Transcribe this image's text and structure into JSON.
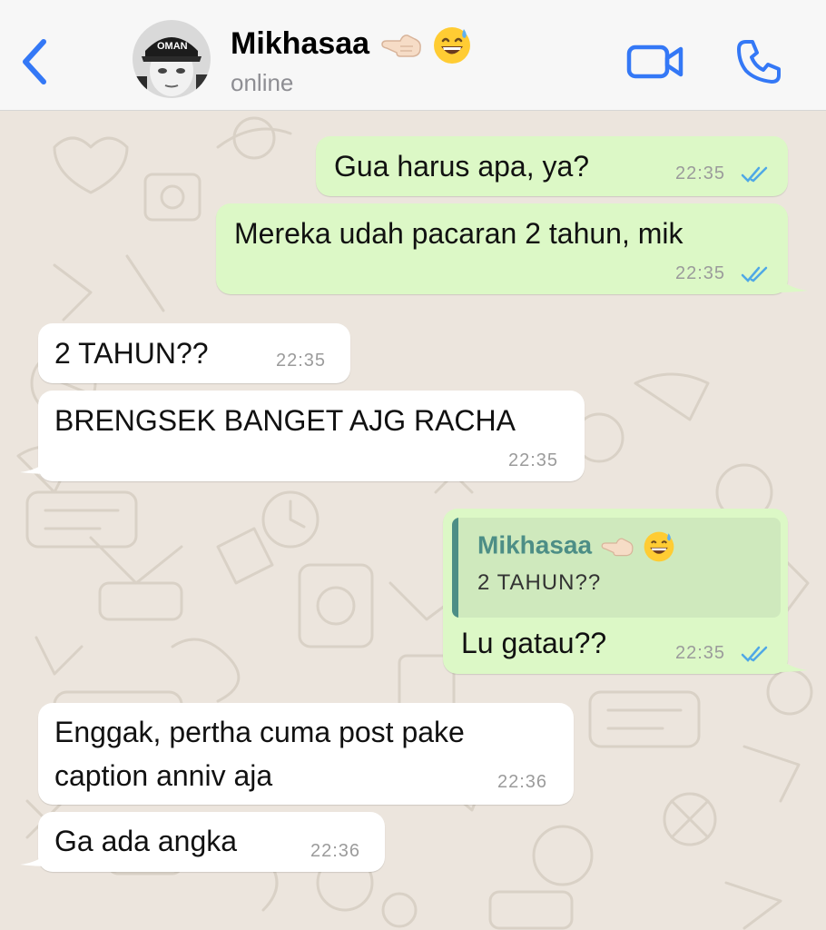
{
  "header": {
    "contact_name": "Mikhasaa",
    "name_emojis": [
      "hand-pointing-left-emoji",
      "grinning-sweat-emoji"
    ],
    "status": "online",
    "accent_color": "#3478f6"
  },
  "theme": {
    "outgoing_bubble": "#dcf8c6",
    "incoming_bubble": "#ffffff",
    "wallpaper": "#ece5dd",
    "read_ticks": "#4fa8e6"
  },
  "messages": [
    {
      "direction": "out",
      "text": "Gua harus apa, ya?",
      "time": "22:35",
      "status": "read"
    },
    {
      "direction": "out",
      "text": "Mereka udah pacaran 2 tahun, mik",
      "time": "22:35",
      "status": "read"
    },
    {
      "direction": "in",
      "text": "2 TAHUN??",
      "time": "22:35"
    },
    {
      "direction": "in",
      "text": "BRENGSEK BANGET AJG RACHA",
      "time": "22:35"
    },
    {
      "direction": "out",
      "quote": {
        "author": "Mikhasaa",
        "text": "2 TAHUN??"
      },
      "text": "Lu gatau??",
      "time": "22:35",
      "status": "read"
    },
    {
      "direction": "in",
      "lines": [
        "Enggak, pertha cuma post pake",
        "caption anniv aja"
      ],
      "time": "22:36"
    },
    {
      "direction": "in",
      "text": "Ga ada angka",
      "time": "22:36"
    }
  ]
}
